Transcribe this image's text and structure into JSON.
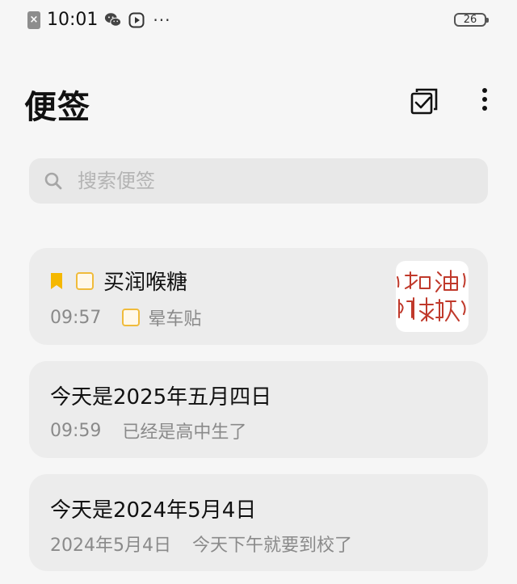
{
  "status_bar": {
    "time": "10:01",
    "battery": "26",
    "icons": [
      "close-badge-icon",
      "wechat-icon",
      "video-play-icon",
      "more-dots-icon",
      "battery-icon"
    ]
  },
  "header": {
    "title": "便签",
    "icons": [
      "edit-check-icon",
      "more-vertical-icon"
    ]
  },
  "search": {
    "placeholder": "搜索便签",
    "value": ""
  },
  "notes": [
    {
      "title": "买润喉糖",
      "time": "09:57",
      "subtitle": "晕车贴",
      "pinned": true,
      "has_checklist": true,
      "thumbnail_text": "加油 加油"
    },
    {
      "title": "今天是2025年五月四日",
      "time": "09:59",
      "subtitle": "已经是高中生了"
    },
    {
      "title": "今天是2024年5月4日",
      "time": "2024年5月4日",
      "subtitle": "今天下午就要到校了"
    }
  ],
  "colors": {
    "background": "#f6f6f6",
    "card": "#ececec",
    "accent_yellow": "#f5b800",
    "checkbox_border": "#f0bb3b",
    "handwriting_red": "#c0392b"
  }
}
